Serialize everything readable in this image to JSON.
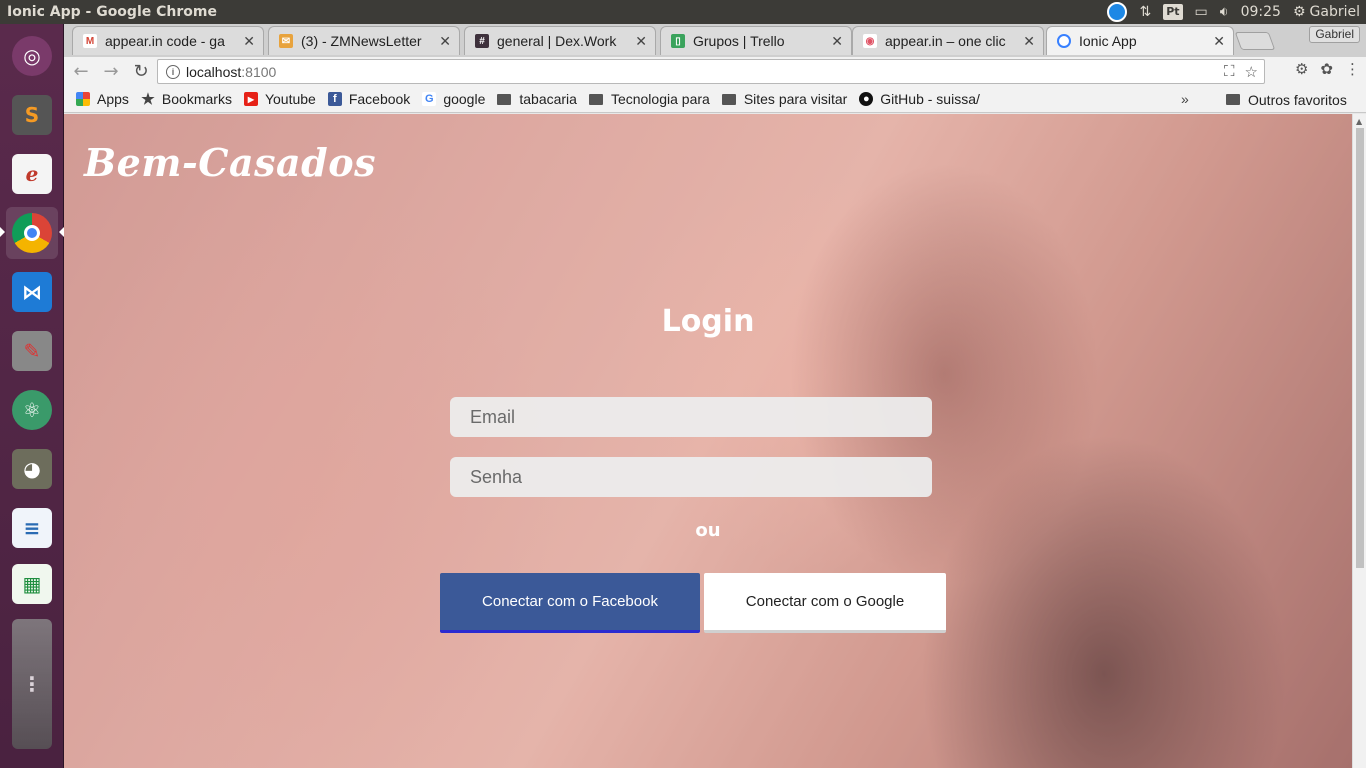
{
  "os": {
    "window_title": "Ionic App - Google Chrome",
    "clock": "09:25",
    "user": "Gabriel",
    "keyboard_layout": "Pt",
    "launcher_icons": [
      "ubuntu-dash-icon",
      "sublime-text-icon",
      "pdf-reader-icon",
      "chrome-icon",
      "vscode-icon",
      "system-tools-icon",
      "atom-icon",
      "gimp-icon",
      "writer-icon",
      "calc-icon",
      "workspace-icon",
      "trash-icon"
    ]
  },
  "tabs": [
    {
      "title": "appear.in code - ga",
      "icon": "gmail-icon",
      "color": "#d44638",
      "glyph": "M"
    },
    {
      "title": "(3) - ZMNewsLetter",
      "icon": "mail-envelope-icon",
      "color": "#e8a33d",
      "glyph": "✉"
    },
    {
      "title": "general | Dex.Work",
      "icon": "slack-hash-icon",
      "color": "#3e313c",
      "glyph": "#"
    },
    {
      "title": "Grupos | Trello",
      "icon": "trello-icon",
      "color": "#3aa35c",
      "glyph": "▯"
    },
    {
      "title": "appear.in – one clic",
      "icon": "appearin-icon",
      "color": "#e05466",
      "glyph": "◉"
    },
    {
      "title": "Ionic App",
      "icon": "ionic-icon",
      "color": "#3880ff",
      "glyph": "○"
    }
  ],
  "profile_badge": "Gabriel",
  "address": {
    "host": "localhost",
    "port": ":8100"
  },
  "bookmarks": [
    {
      "label": "Apps",
      "kind": "apps"
    },
    {
      "label": "Bookmarks",
      "kind": "star"
    },
    {
      "label": "Youtube",
      "kind": "youtube"
    },
    {
      "label": "Facebook",
      "kind": "facebook"
    },
    {
      "label": "google",
      "kind": "google"
    },
    {
      "label": "tabacaria",
      "kind": "folder"
    },
    {
      "label": "Tecnologia para",
      "kind": "folder"
    },
    {
      "label": "Sites para visitar",
      "kind": "folder"
    },
    {
      "label": "GitHub - suissa/",
      "kind": "github"
    }
  ],
  "bookmarks_overflow": "»",
  "other_bookmarks": "Outros favoritos",
  "app": {
    "brand": "Bem-Casados",
    "title": "Login",
    "email_placeholder": "Email",
    "password_placeholder": "Senha",
    "or_text": "ou",
    "facebook_button": "Conectar com o Facebook",
    "google_button": "Conectar com o Google"
  },
  "colors": {
    "facebook": "#3b5998",
    "google_button_bg": "#ffffff",
    "launcher_bg": "#5a2a4c"
  }
}
